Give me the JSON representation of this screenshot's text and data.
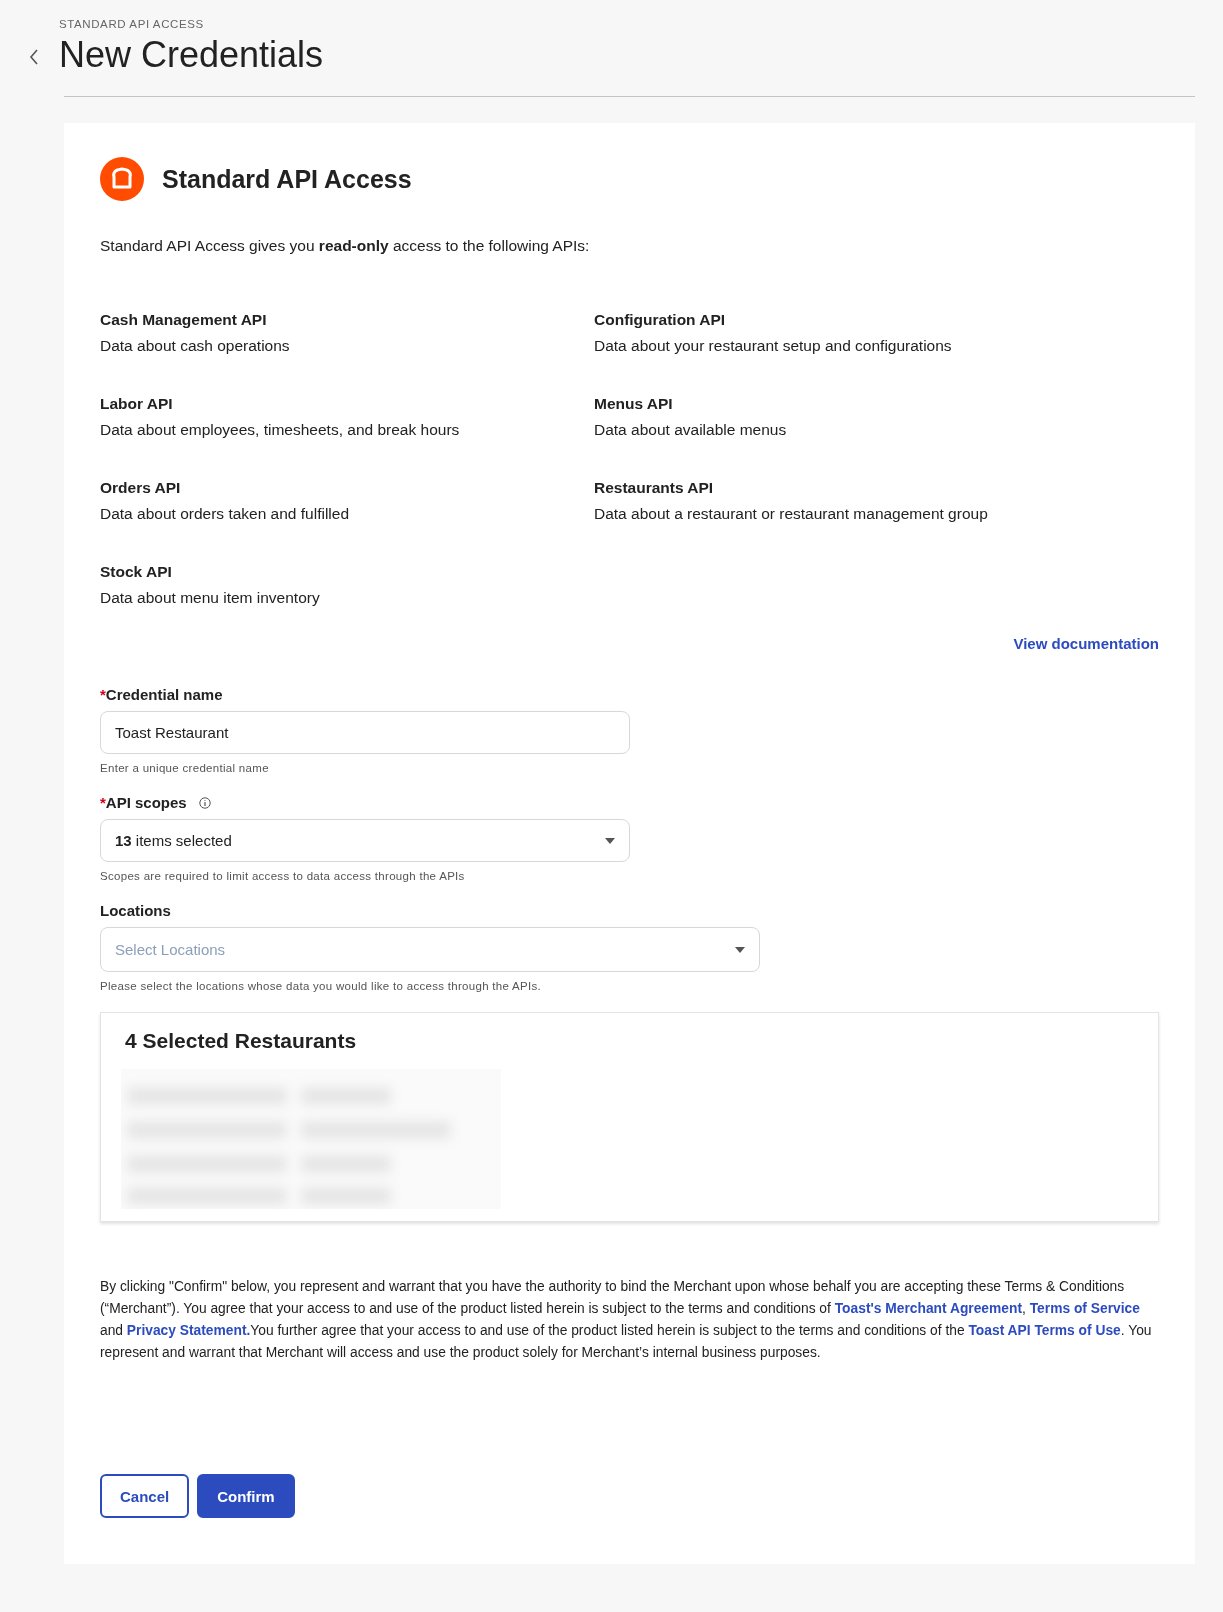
{
  "header": {
    "eyebrow": "STANDARD API ACCESS",
    "title": "New Credentials"
  },
  "card": {
    "title": "Standard API Access",
    "intro": "Standard API Access gives you **read-only** access to the following APIs:",
    "apis": [
      {
        "name": "Cash Management API",
        "description": "Data about cash operations"
      },
      {
        "name": "Configuration API",
        "description": "Data about your restaurant setup and configurations"
      },
      {
        "name": "Labor API",
        "description": "Data about employees, timesheets, and break hours"
      },
      {
        "name": "Menus API",
        "description": "Data about available menus"
      },
      {
        "name": "Orders API",
        "description": "Data about orders taken and fulfilled"
      },
      {
        "name": "Restaurants API",
        "description": "Data about a restaurant or restaurant management group"
      },
      {
        "name": "Stock API",
        "description": "Data about menu item inventory"
      }
    ],
    "doc_link": "View documentation",
    "fields": [
      {
        "kind": "text",
        "required_mark": "*",
        "label": "Credential name",
        "value": "Toast Restaurant",
        "help": "Enter a unique credential name"
      },
      {
        "kind": "select",
        "required_mark": "*",
        "info": true,
        "label": "API scopes",
        "count": "13",
        "value": "items selected",
        "help": "Scopes are required to limit access to data access through the APIs"
      },
      {
        "kind": "select",
        "wide": true,
        "label": "Locations",
        "placeholder": "Select Locations",
        "help": "Please select the locations whose data you would like to access through the APIs."
      }
    ],
    "selected_panel": {
      "title": "4 Selected Restaurants"
    },
    "terms": [
      {
        "kind": "text",
        "text": "By clicking \"Confirm\" below, you represent and warrant that you have the authority to bind the Merchant upon whose behalf you are accepting these Terms & Conditions (“Merchant”). You agree that your access to and use of the product listed herein is subject to the terms and conditions of "
      },
      {
        "kind": "link",
        "text": "Toast's Merchant Agreement"
      },
      {
        "kind": "text",
        "text": ", "
      },
      {
        "kind": "link",
        "text": "Terms of Service"
      },
      {
        "kind": "text",
        "text": " and "
      },
      {
        "kind": "link",
        "text": "Privacy Statement."
      },
      {
        "kind": "text",
        "text": "You further agree that your access to and use of the product listed herein is subject to the terms and conditions of the "
      },
      {
        "kind": "link",
        "text": "Toast API Terms of Use"
      },
      {
        "kind": "text",
        "text": ". You represent and warrant that Merchant will access and use the product solely for Merchant’s internal business purposes."
      }
    ],
    "buttons": [
      {
        "kind": "secondary",
        "label": "Cancel"
      },
      {
        "kind": "primary",
        "label": "Confirm"
      }
    ]
  }
}
